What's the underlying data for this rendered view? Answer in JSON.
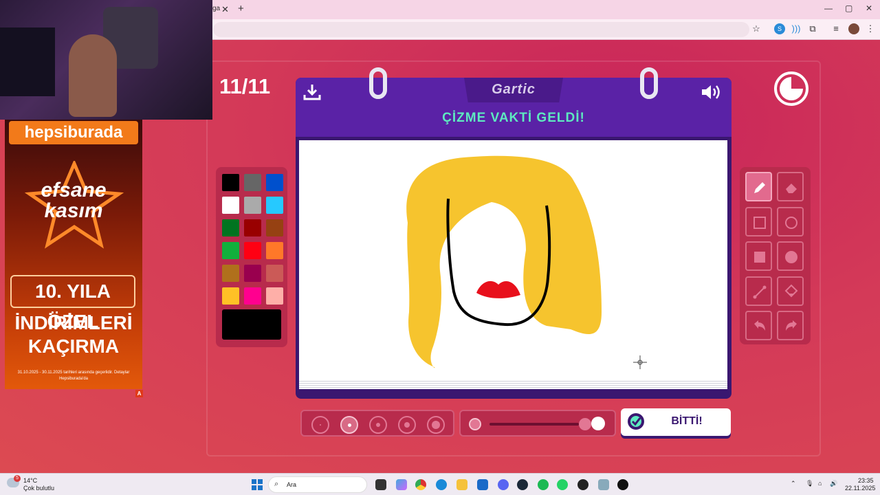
{
  "browser": {
    "tab_fragment": "ga",
    "close_glyph": "✕",
    "new_tab_glyph": "+",
    "window_controls": [
      "—",
      "▢",
      "✕"
    ],
    "toolbar_icons": [
      "star-icon",
      "extension-icon",
      "sound-icon",
      "puzzle-icon",
      "media-icon",
      "avatar",
      "more-icon"
    ]
  },
  "game": {
    "round": "11/11",
    "logo": "Gartic",
    "headline": "ÇİZME VAKTİ GELDİ!",
    "done_label": "BİTTİ!",
    "palette": [
      "#000000",
      "#666666",
      "#0050cd",
      "#ffffff",
      "#aaaaaa",
      "#26c9ff",
      "#017420",
      "#990000",
      "#964112",
      "#11b03c",
      "#ff0013",
      "#ff7829",
      "#b0701c",
      "#99004e",
      "#cb5a57",
      "#ffc126",
      "#ff008f",
      "#feafa8"
    ],
    "current_color": "#000000",
    "tools": [
      "pencil-icon",
      "eraser-icon",
      "rectangle-outline-icon",
      "ellipse-outline-icon",
      "rectangle-fill-icon",
      "ellipse-fill-icon",
      "line-icon",
      "fill-bucket-icon",
      "undo-icon",
      "redo-icon"
    ],
    "active_tool": "pencil",
    "brush_sizes": 5,
    "selected_brush_size": 2,
    "opacity_level": 1.0
  },
  "ad": {
    "brand": "hepsiburada",
    "campaign_line1": "efsane",
    "campaign_line2": "kasım",
    "box_text": "10. YILA ÖZEL",
    "line2": "İNDİRİMLERİ",
    "line3": "KAÇIRMA",
    "fine_print": "31.10.2025 - 30.11.2025 tarihleri arasında geçerlidir. Detaylar Hepsiburada'da",
    "badge": "A"
  },
  "taskbar": {
    "weather_temp": "14°C",
    "weather_desc": "Çok bulutlu",
    "weather_badge": "5",
    "search_placeholder": "Ara",
    "time": "23:35",
    "date": "22.11.2025"
  }
}
